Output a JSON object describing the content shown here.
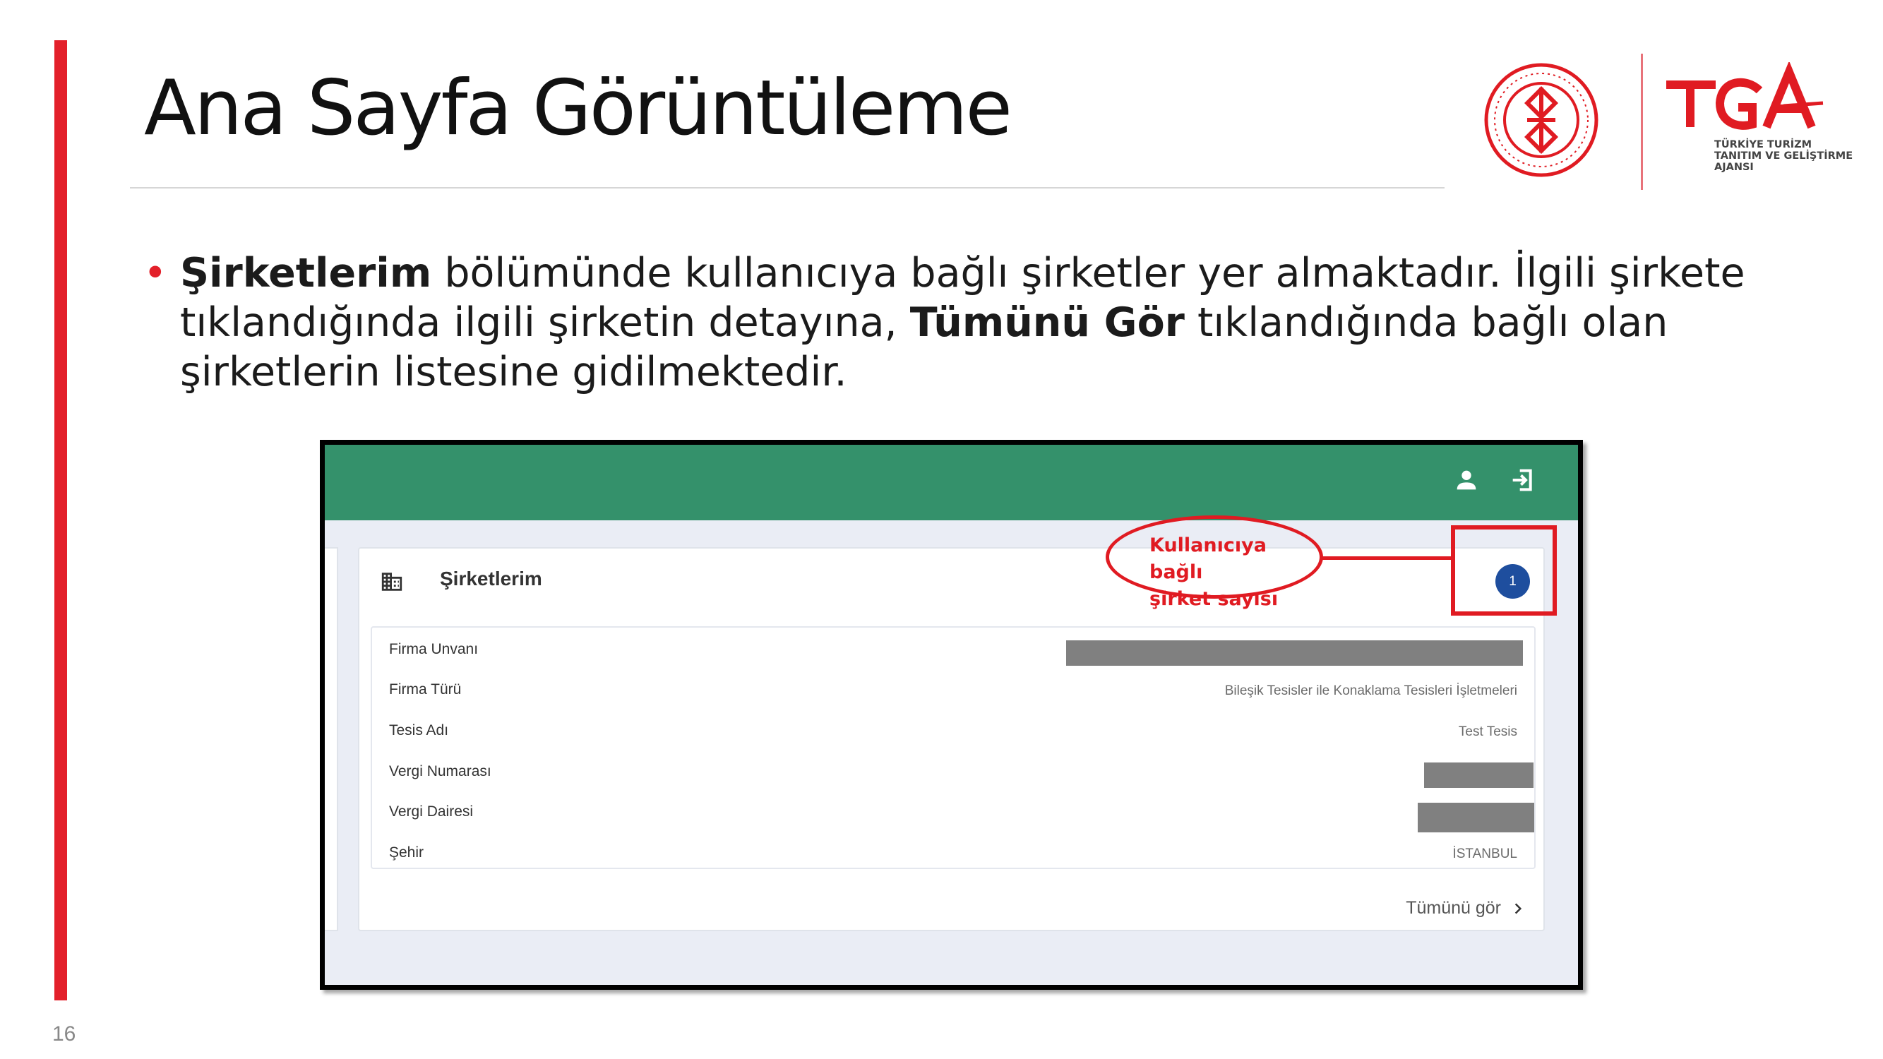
{
  "slide": {
    "title": "Ana Sayfa Görüntüleme",
    "page_number": "16",
    "accent_color": "#e3202a"
  },
  "bullet": {
    "part1_bold": "Şirketlerim",
    "part2": " bölümünde kullanıcıya bağlı şirketler yer almaktadır. İlgili şirkete tıklandığında ilgili şirketin detayına, ",
    "part3_bold": "Tümünü Gör",
    "part4": " tıklandığında bağlı olan şirketlerin listesine gidilmektedir."
  },
  "logos": {
    "ministry_icon": "ministry-seal-icon",
    "tga_mark": "TGA",
    "tga_line1": "TÜRKİYE TURİZM",
    "tga_line2": "TANITIM VE GELİŞTİRME",
    "tga_line3": "AJANSI"
  },
  "app": {
    "header_color": "#34916b",
    "header_icons": [
      "user-icon",
      "logout-icon"
    ],
    "card": {
      "icon": "building-icon",
      "title": "Şirketlerim",
      "count": "1",
      "badge_color": "#1e4e9e",
      "rows": [
        {
          "label": "Firma Unvanı",
          "value": null,
          "redacted": true
        },
        {
          "label": "Firma Türü",
          "value": "Bileşik Tesisler ile Konaklama Tesisleri İşletmeleri",
          "redacted": false
        },
        {
          "label": "Tesis Adı",
          "value": "Test Tesis",
          "redacted": false
        },
        {
          "label": "Vergi Numarası",
          "value": null,
          "redacted": true
        },
        {
          "label": "Vergi Dairesi",
          "value": null,
          "redacted": true
        },
        {
          "label": "Şehir",
          "value": "İSTANBUL",
          "redacted": false
        }
      ],
      "see_all": "Tümünü gör"
    }
  },
  "annotation": {
    "text_line1": "Kullanıcıya bağlı",
    "text_line2": "şirket sayısı",
    "color": "#e01b22"
  }
}
